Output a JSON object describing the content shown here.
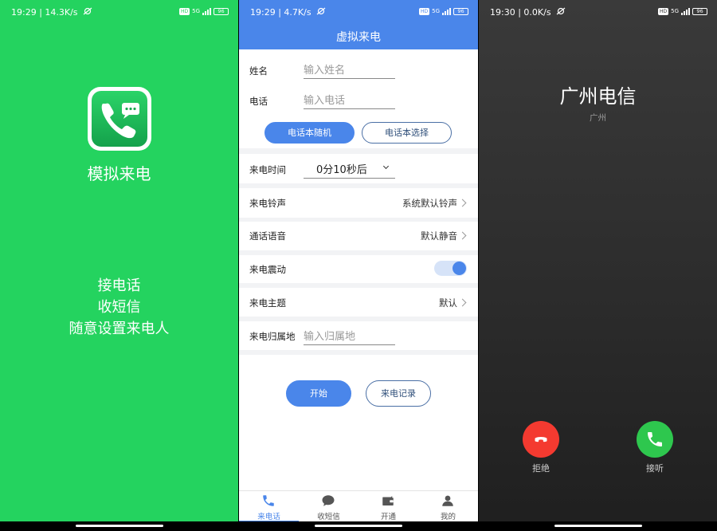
{
  "splash": {
    "status": {
      "time_speed": "19:29 | 14.3K/s",
      "hd": "HD",
      "net": "5G",
      "battery": "96"
    },
    "app_name": "模拟来电",
    "slogans": [
      "接电话",
      "收短信",
      "随意设置来电人"
    ]
  },
  "form": {
    "status": {
      "time_speed": "19:29 | 4.7K/s",
      "hd": "HD",
      "net": "5G",
      "battery": "96"
    },
    "title": "虚拟来电",
    "name_label": "姓名",
    "name_placeholder": "输入姓名",
    "phone_label": "电话",
    "phone_placeholder": "输入电话",
    "random_contact_button": "电话本随机",
    "choose_contact_button": "电话本选择",
    "call_time_label": "来电时间",
    "call_time_value": "0分10秒后",
    "ringtone_label": "来电铃声",
    "ringtone_value": "系统默认铃声",
    "voice_label": "通话语音",
    "voice_value": "默认静音",
    "vibration_label": "来电震动",
    "vibration_on": true,
    "theme_label": "来电主题",
    "theme_value": "默认",
    "location_label": "来电归属地",
    "location_placeholder": "输入归属地",
    "start_button": "开始",
    "history_button": "来电记录",
    "tabs": [
      {
        "label": "来电话",
        "icon": "phone-icon",
        "active": true
      },
      {
        "label": "收短信",
        "icon": "message-icon",
        "active": false
      },
      {
        "label": "开通",
        "icon": "wallet-icon",
        "active": false
      },
      {
        "label": "我的",
        "icon": "user-icon",
        "active": false
      }
    ],
    "accent_color": "#4a86ea"
  },
  "incoming": {
    "status": {
      "time_speed": "19:30 | 0.0K/s",
      "hd": "HD",
      "net": "5G",
      "battery": "96"
    },
    "caller_name": "广州电信",
    "caller_location": "广州",
    "decline_label": "拒绝",
    "accept_label": "接听",
    "decline_color": "#f43a30",
    "accept_color": "#2ec74e"
  }
}
